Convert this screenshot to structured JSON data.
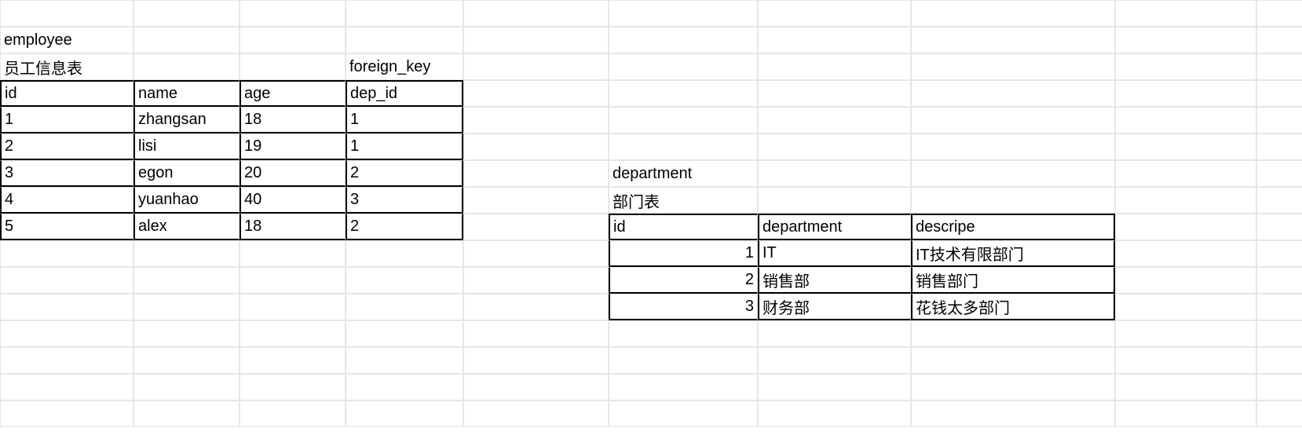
{
  "employee": {
    "title": "employee",
    "subtitle": "员工信息表",
    "fk_label": "foreign_key",
    "headers": [
      "id",
      "name",
      "age",
      "dep_id"
    ],
    "rows": [
      [
        "1",
        "zhangsan",
        "18",
        "1"
      ],
      [
        "2",
        "lisi",
        "19",
        "1"
      ],
      [
        "3",
        "egon",
        "20",
        "2"
      ],
      [
        "4",
        "yuanhao",
        "40",
        "3"
      ],
      [
        "5",
        "alex",
        "18",
        "2"
      ]
    ]
  },
  "department": {
    "title": "department",
    "subtitle": "部门表",
    "headers": [
      "id",
      "department",
      "descripe"
    ],
    "rows": [
      [
        "1",
        "IT",
        "IT技术有限部门"
      ],
      [
        "2",
        "销售部",
        "销售部门"
      ],
      [
        "3",
        "财务部",
        "花钱太多部门"
      ]
    ]
  }
}
